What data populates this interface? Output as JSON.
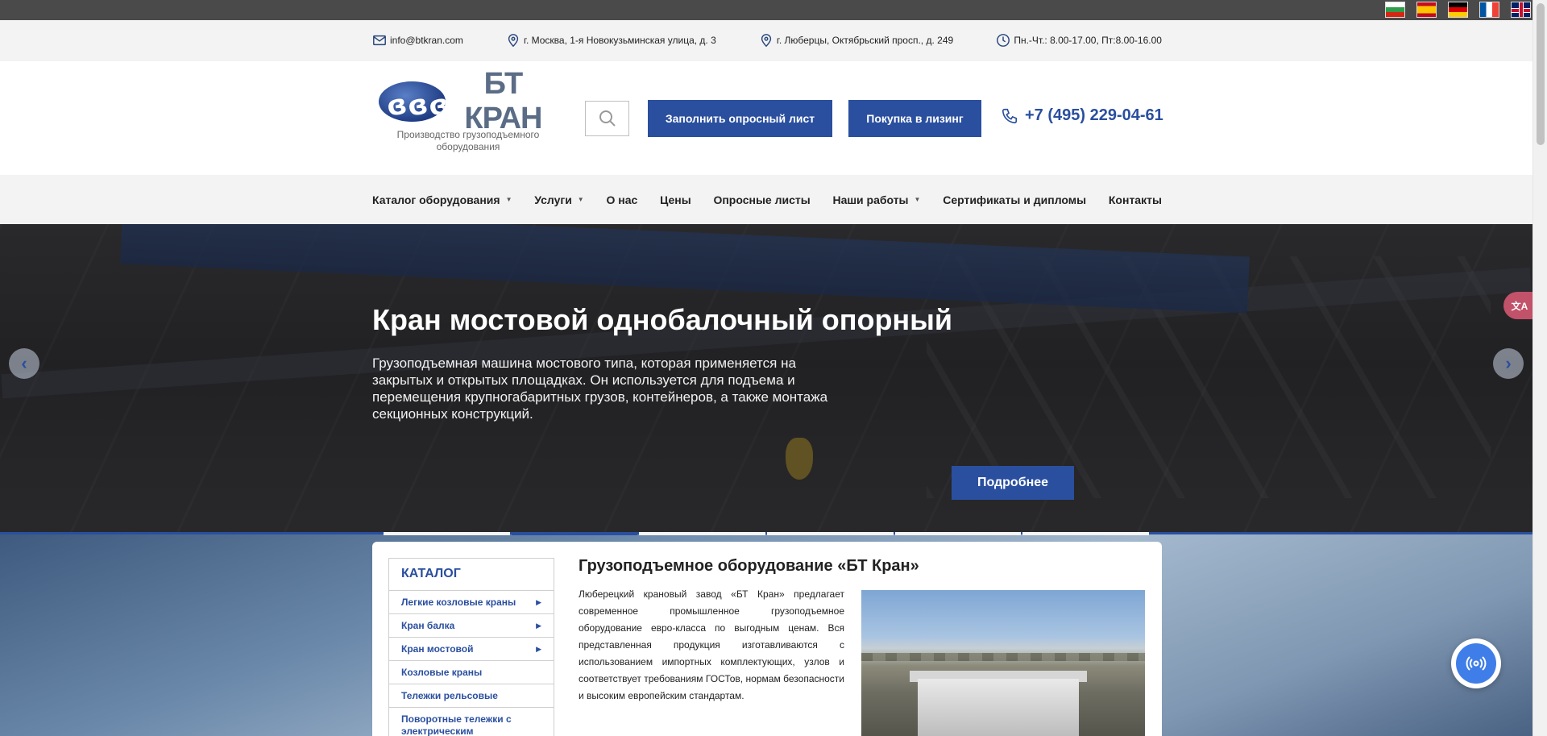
{
  "languages": [
    {
      "code": "bg",
      "icon": "bulgaria-flag-icon"
    },
    {
      "code": "es",
      "icon": "spain-flag-icon"
    },
    {
      "code": "de",
      "icon": "germany-flag-icon"
    },
    {
      "code": "fr",
      "icon": "france-flag-icon"
    },
    {
      "code": "gb",
      "icon": "uk-flag-icon"
    }
  ],
  "contacts": {
    "email": "info@btkran.com",
    "address_moscow": "г. Москва, 1-я Новокузьминская улица, д. 3",
    "address_lyubertsy": "г. Люберцы, Октябрьский просп., д. 249",
    "hours": "Пн.-Чт.: 8.00-17.00, Пт:8.00-16.00"
  },
  "header": {
    "logo_text": "БТ КРАН",
    "logo_subtitle": "Производство грузоподъемного оборудования",
    "survey_button": "Заполнить опросный лист",
    "leasing_button": "Покупка в лизинг",
    "phone": "+7 (495) 229-04-61"
  },
  "nav": {
    "items": [
      {
        "label": "Каталог оборудования",
        "dropdown": true
      },
      {
        "label": "Услуги",
        "dropdown": true
      },
      {
        "label": "О нас",
        "dropdown": false
      },
      {
        "label": "Цены",
        "dropdown": false
      },
      {
        "label": "Опросные листы",
        "dropdown": false
      },
      {
        "label": "Наши работы",
        "dropdown": true
      },
      {
        "label": "Сертификаты и дипломы",
        "dropdown": false
      },
      {
        "label": "Контакты",
        "dropdown": false
      }
    ]
  },
  "hero": {
    "title": "Кран мостовой однобалочный опорный",
    "description": "Грузоподъемная машина мостового типа, которая применяется на закрытых и открытых площадках. Он используется для подъема и перемещения крупногабаритных грузов, контейнеров, а также монтажа секционных конструкций.",
    "button": "Подробнее",
    "slides": 6,
    "active_slide": 2
  },
  "catalog": {
    "title": "КАТАЛОГ",
    "items": [
      {
        "label": "Легкие козловые краны",
        "has_submenu": true
      },
      {
        "label": "Кран балка",
        "has_submenu": true
      },
      {
        "label": "Кран мостовой",
        "has_submenu": true
      },
      {
        "label": "Козловые краны",
        "has_submenu": false
      },
      {
        "label": "Тележки рельсовые",
        "has_submenu": false
      },
      {
        "label": "Поворотные тележки с электрическим передвижением",
        "has_submenu": false
      }
    ]
  },
  "main": {
    "title": "Грузоподъемное оборудование «БТ Кран»",
    "text": "Люберецкий крановый завод «БТ Кран» предлагает современное промышленное грузоподъемное оборудование евро-класса по выгодным ценам. Вся представленная продукция изготавливаются с использованием импортных комплектующих, узлов и соответствует требованиям ГОСТов, нормам безопасности и высоким европейским стандартам."
  },
  "colors": {
    "brand_blue": "#2a4f9f",
    "top_bar": "#4a4a4a",
    "light_bar": "#f3f3f3"
  }
}
